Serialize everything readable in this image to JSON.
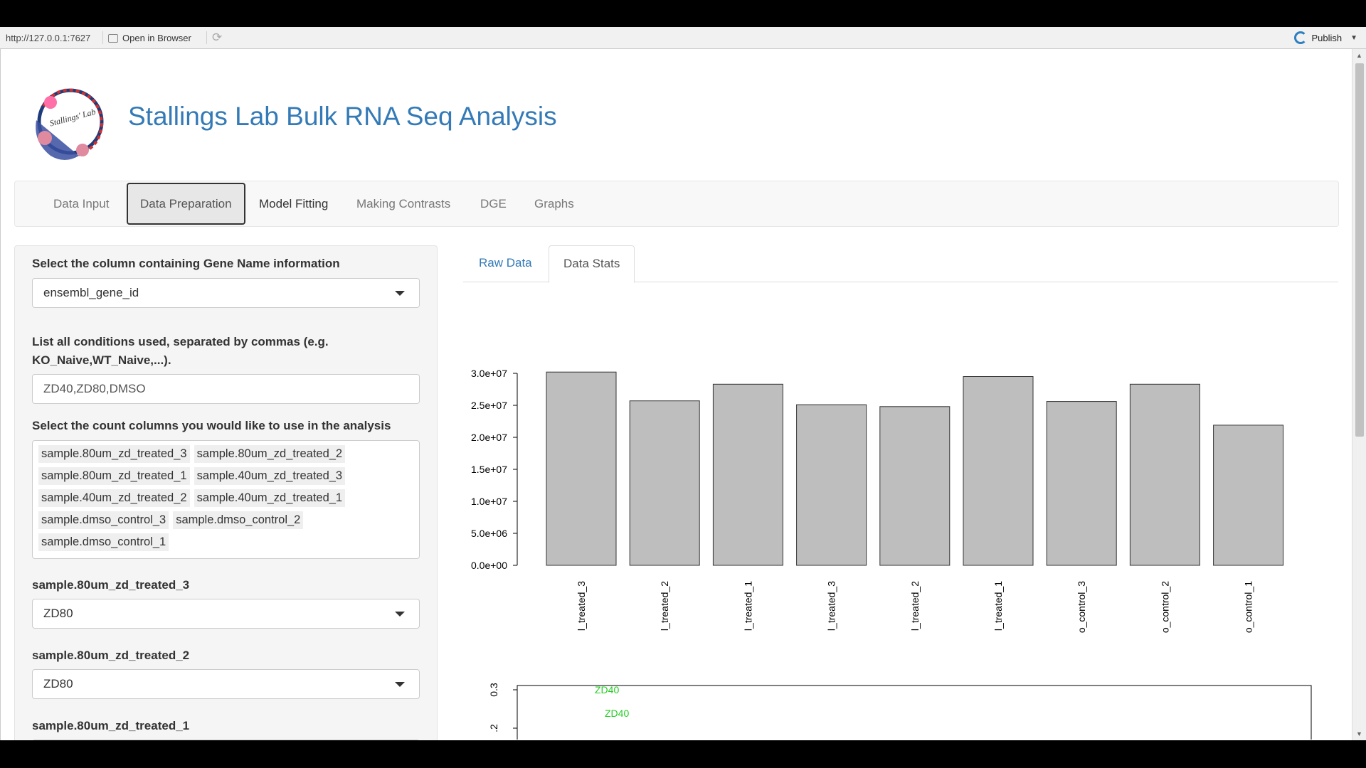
{
  "browser": {
    "url": "http://127.0.0.1:7627",
    "open_in_browser": "Open in Browser",
    "publish": "Publish"
  },
  "app": {
    "title": "Stallings Lab Bulk RNA Seq Analysis",
    "logo_text": "Stallings' Lab"
  },
  "nav": {
    "tabs": [
      {
        "label": "Data Input",
        "state": "default"
      },
      {
        "label": "Data Preparation",
        "state": "active"
      },
      {
        "label": "Model Fitting",
        "state": "hover"
      },
      {
        "label": "Making Contrasts",
        "state": "default"
      },
      {
        "label": "DGE",
        "state": "default"
      },
      {
        "label": "Graphs",
        "state": "default"
      }
    ]
  },
  "sidebar": {
    "gene_col_label": "Select the column containing Gene Name information",
    "gene_col_value": "ensembl_gene_id",
    "conditions_label": "List all conditions used, separated by commas (e.g. KO_Naive,WT_Naive,...).",
    "conditions_value": "ZD40,ZD80,DMSO",
    "count_cols_label": "Select the count columns you would like to use in the analysis",
    "count_cols": [
      "sample.80um_zd_treated_3",
      "sample.80um_zd_treated_2",
      "sample.80um_zd_treated_1",
      "sample.40um_zd_treated_3",
      "sample.40um_zd_treated_2",
      "sample.40um_zd_treated_1",
      "sample.dmso_control_3",
      "sample.dmso_control_2",
      "sample.dmso_control_1"
    ],
    "sample_selects": [
      {
        "label": "sample.80um_zd_treated_3",
        "value": "ZD80"
      },
      {
        "label": "sample.80um_zd_treated_2",
        "value": "ZD80"
      },
      {
        "label": "sample.80um_zd_treated_1",
        "value": ""
      }
    ]
  },
  "main": {
    "tabs": [
      {
        "label": "Raw Data",
        "state": "default"
      },
      {
        "label": "Data Stats",
        "state": "active"
      }
    ]
  },
  "chart_data": [
    {
      "type": "bar",
      "categories": [
        "l_treated_3",
        "l_treated_2",
        "l_treated_1",
        "l_treated_3",
        "l_treated_2",
        "l_treated_1",
        "o_control_3",
        "o_control_2",
        "o_control_1"
      ],
      "values": [
        30200000,
        25700000,
        28300000,
        25100000,
        24800000,
        29500000,
        25600000,
        28300000,
        21900000
      ],
      "ylim": [
        0,
        30000000
      ],
      "yticks": [
        "0.0e+00",
        "5.0e+06",
        "1.0e+07",
        "1.5e+07",
        "2.0e+07",
        "2.5e+07",
        "3.0e+07"
      ],
      "ytick_values": [
        0,
        5000000,
        10000000,
        15000000,
        20000000,
        25000000,
        30000000
      ],
      "bar_color": "#bebebe",
      "title": "",
      "xlabel": "",
      "ylabel": ""
    },
    {
      "type": "scatter",
      "yticks": [
        "0.3",
        ".2"
      ],
      "ytick_values": [
        0.3,
        0.2
      ],
      "points": [
        {
          "label": "ZD40",
          "color": "#22cc22"
        },
        {
          "label": "ZD40",
          "color": "#22cc22"
        }
      ]
    }
  ]
}
